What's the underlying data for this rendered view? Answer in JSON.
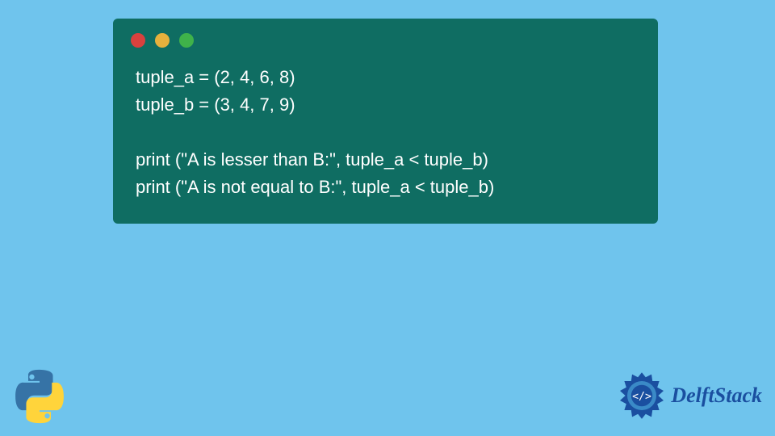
{
  "code": {
    "line1": "tuple_a = (2, 4, 6, 8)",
    "line2": "tuple_b = (3, 4, 7, 9)",
    "line3": "",
    "line4": "print (\"A is lesser than B:\", tuple_a < tuple_b)",
    "line5": "print (\"A is not equal to B:\", tuple_a < tuple_b)"
  },
  "brand": {
    "name": "DelftStack"
  },
  "icons": {
    "python": "python-logo",
    "delft": "delft-gear-icon"
  }
}
